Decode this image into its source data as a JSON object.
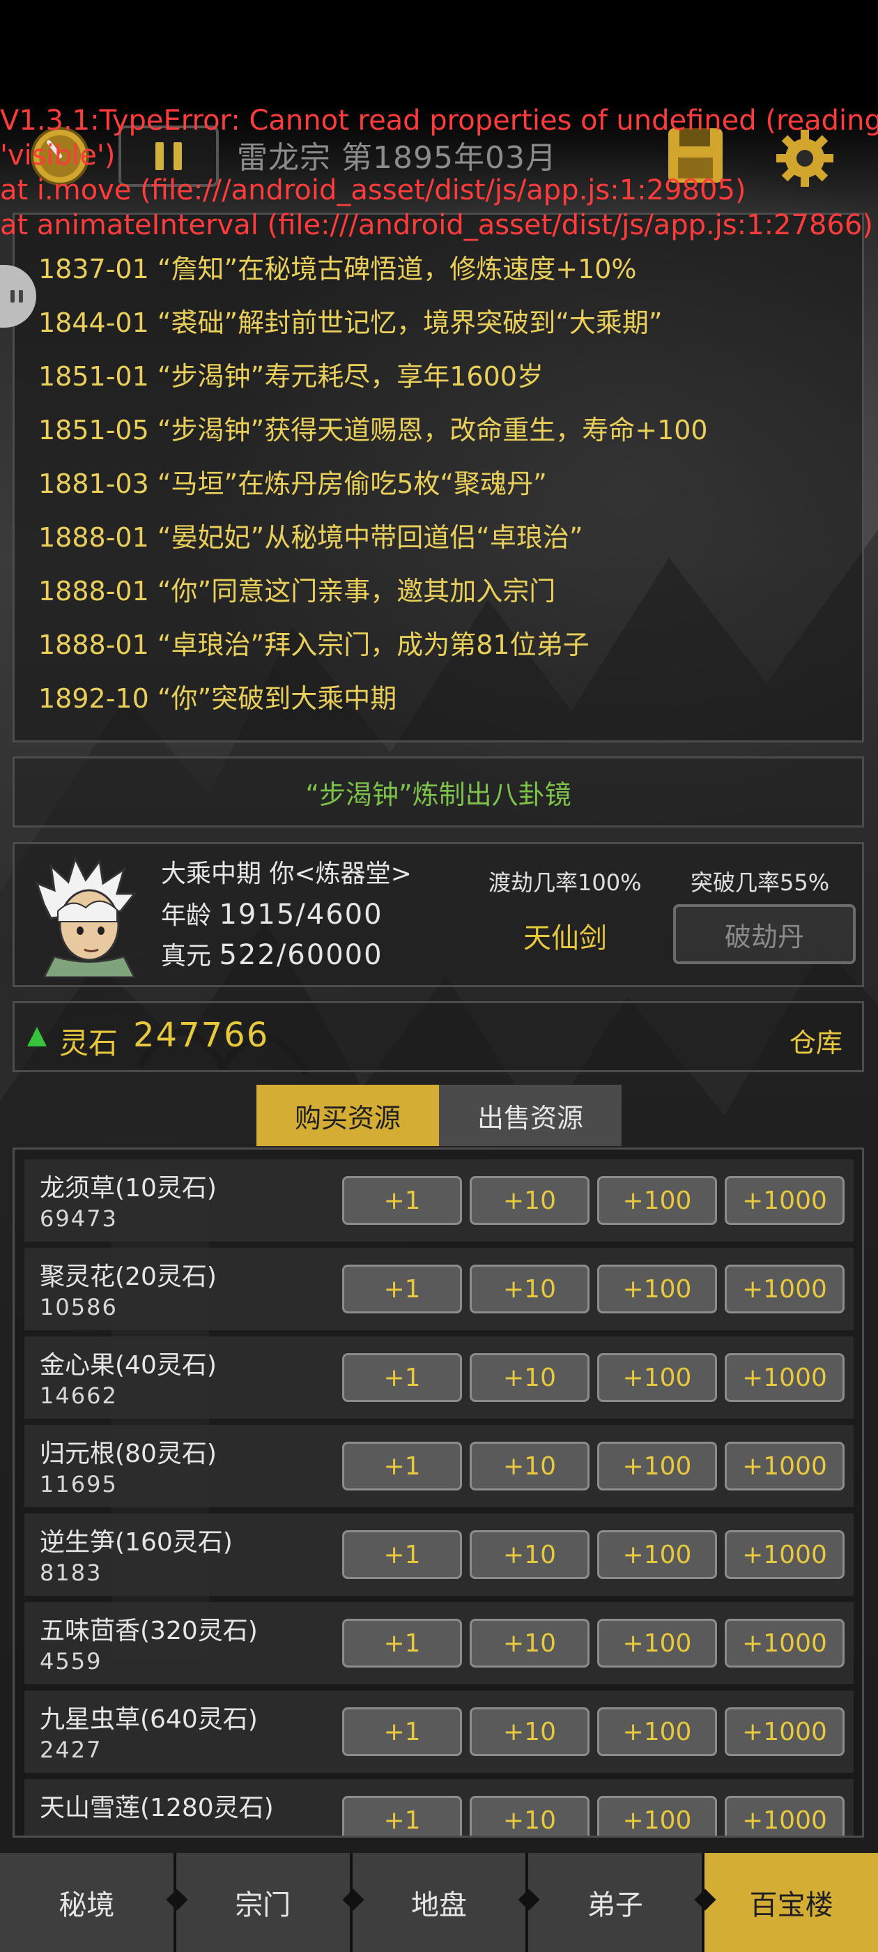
{
  "error": {
    "lines": [
      "V1.3.1:TypeError: Cannot read properties of undefined (reading",
      "'visible')",
      "at i.move (file:///android_asset/dist/js/app.js:1:29805)",
      "at animateInterval (file:///android_asset/dist/js/app.js:1:27866)"
    ]
  },
  "header": {
    "title": "雷龙宗 第1895年03月"
  },
  "log": {
    "entries": [
      "1837-01 “詹知”在秘境古碑悟道，修炼速度+10%",
      "1844-01 “裘础”解封前世记忆，境界突破到“大乘期”",
      "1851-01 “步渴钟”寿元耗尽，享年1600岁",
      "1851-05 “步渴钟”获得天道赐恩，改命重生，寿命+100",
      "1881-03 “马垣”在炼丹房偷吃5枚“聚魂丹”",
      "1888-01 “晏妃妃”从秘境中带回道侣“卓琅治”",
      "1888-01 “你”同意这门亲事，邀其加入宗门",
      "1888-01 “卓琅治”拜入宗门，成为第81位弟子",
      "1892-10 “你”突破到大乘中期"
    ]
  },
  "notice": "“步渴钟”炼制出八卦镜",
  "character": {
    "realm_line": "大乘中期 你<炼器堂>",
    "age_label": "年龄",
    "age_value": "1915/4600",
    "qi_label": "真元",
    "qi_value": "522/60000",
    "tribulation_rate": "渡劫几率100%",
    "breakthrough_rate": "突破几率55%",
    "equipment": "天仙剑",
    "pill_button": "破劫丹"
  },
  "resources": {
    "label": "灵石",
    "value": "247766",
    "warehouse": "仓库"
  },
  "tabs": {
    "buy": "购买资源",
    "sell": "出售资源"
  },
  "shop": {
    "button_labels": [
      "+1",
      "+10",
      "+100",
      "+1000"
    ],
    "items": [
      {
        "name": "龙须草(10灵石)",
        "stock": "69473"
      },
      {
        "name": "聚灵花(20灵石)",
        "stock": "10586"
      },
      {
        "name": "金心果(40灵石)",
        "stock": "14662"
      },
      {
        "name": "归元根(80灵石)",
        "stock": "11695"
      },
      {
        "name": "逆生笋(160灵石)",
        "stock": "8183"
      },
      {
        "name": "五味茴香(320灵石)",
        "stock": "4559"
      },
      {
        "name": "九星虫草(640灵石)",
        "stock": "2427"
      },
      {
        "name": "天山雪莲(1280灵石)",
        "stock": ""
      }
    ]
  },
  "nav": {
    "items": [
      "秘境",
      "宗门",
      "地盘",
      "弟子",
      "百宝楼"
    ],
    "active": "百宝楼"
  },
  "colors": {
    "accent_gold": "#d4ad34",
    "text_yellow": "#ead05a",
    "notice_green": "#7dc24a",
    "error_red": "#ff3b3b"
  }
}
